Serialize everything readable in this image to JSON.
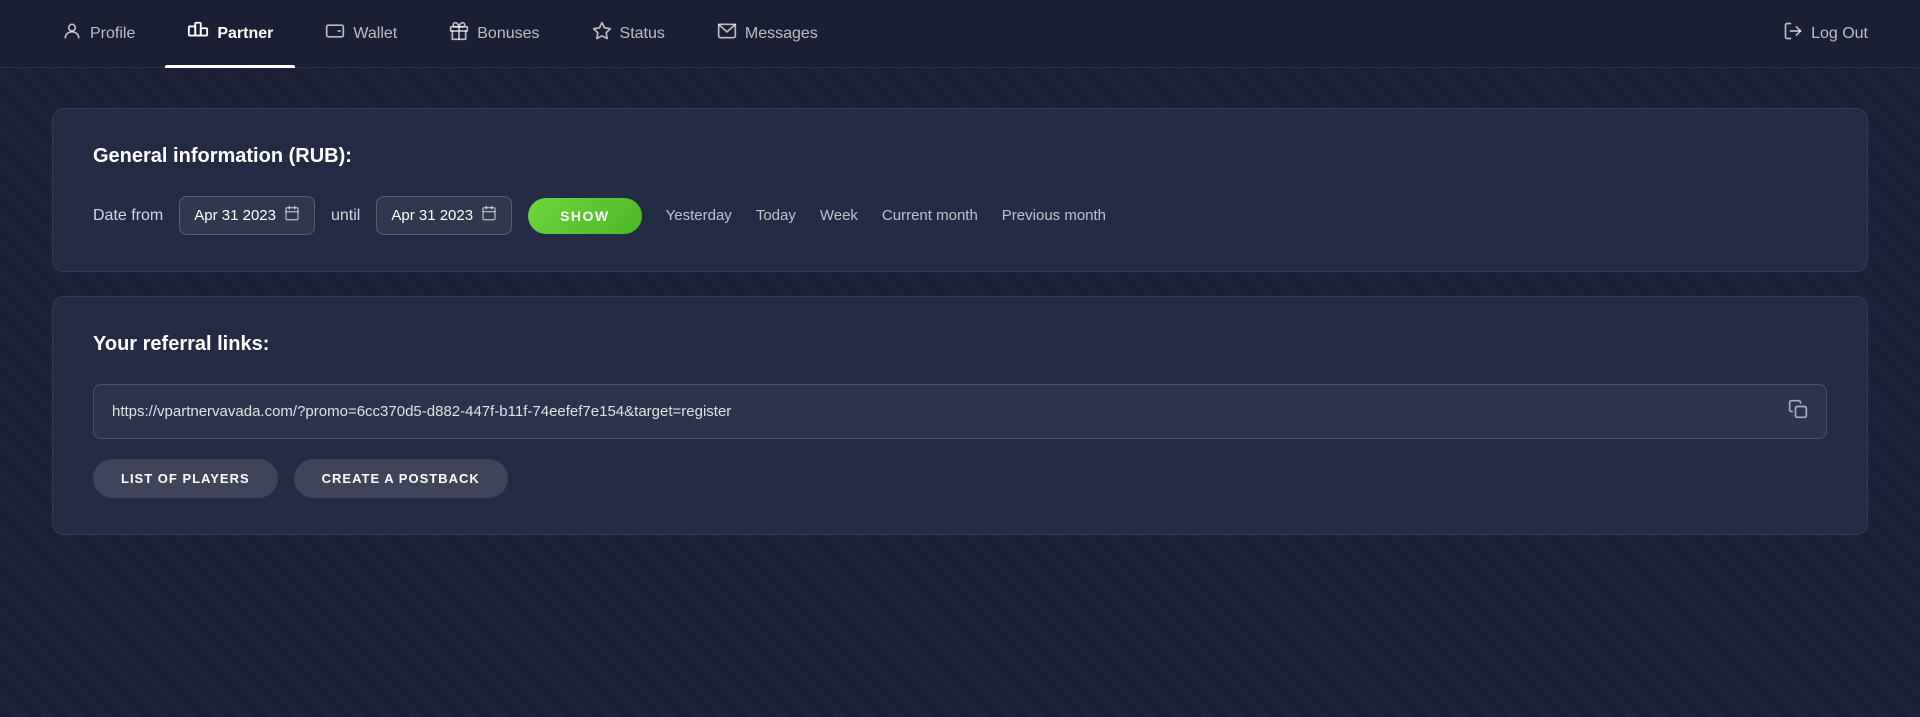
{
  "nav": {
    "items": [
      {
        "id": "profile",
        "label": "Profile",
        "icon": "person",
        "active": false
      },
      {
        "id": "partner",
        "label": "Partner",
        "icon": "partner",
        "active": true
      },
      {
        "id": "wallet",
        "label": "Wallet",
        "icon": "wallet",
        "active": false
      },
      {
        "id": "bonuses",
        "label": "Bonuses",
        "icon": "gift",
        "active": false
      },
      {
        "id": "status",
        "label": "Status",
        "icon": "star",
        "active": false
      },
      {
        "id": "messages",
        "label": "Messages",
        "icon": "envelope",
        "active": false
      }
    ],
    "logout_label": "Log Out"
  },
  "general_info_card": {
    "title": "General information (RUB):",
    "date_from_label": "Date from",
    "date_from_value": "Apr 31 2023",
    "until_label": "until",
    "date_until_value": "Apr 31 2023",
    "show_button": "SHOW",
    "quick_filters": [
      {
        "id": "yesterday",
        "label": "Yesterday"
      },
      {
        "id": "today",
        "label": "Today"
      },
      {
        "id": "week",
        "label": "Week"
      },
      {
        "id": "current_month",
        "label": "Current month"
      },
      {
        "id": "previous_month",
        "label": "Previous month"
      }
    ]
  },
  "referral_card": {
    "title": "Your referral links:",
    "url": "https://vpartnervavada.com/?promo=6cc370d5-d882-447f-b11f-74eefef7e154&target=register",
    "list_players_button": "LIST OF PLAYERS",
    "create_postback_button": "CREATE A POSTBACK"
  }
}
